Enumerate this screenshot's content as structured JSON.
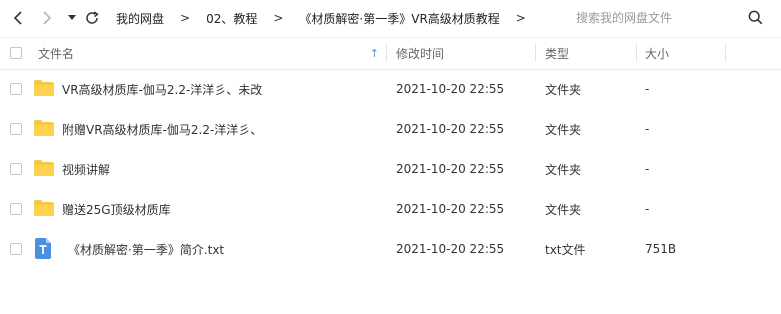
{
  "toolbar": {
    "back_icon": "chevron-left-icon",
    "forward_icon": "chevron-right-icon",
    "history_icon": "caret-down-icon",
    "refresh_icon": "refresh-icon",
    "breadcrumb": [
      {
        "label": "我的网盘"
      },
      {
        "label": "02、教程"
      },
      {
        "label": "《材质解密·第一季》VR高级材质教程"
      }
    ],
    "breadcrumb_separator": ">",
    "search_placeholder": "搜索我的网盘文件"
  },
  "columns": {
    "name": "文件名",
    "modified": "修改时间",
    "type": "类型",
    "size": "大小",
    "sort_indicator": "↑"
  },
  "files": [
    {
      "name": "VR高级材质库-伽马2.2-洋洋彡、未改",
      "modified": "2021-10-20 22:55",
      "type": "文件夹",
      "size": "-",
      "icon": "folder"
    },
    {
      "name": "附赠VR高级材质库-伽马2.2-洋洋彡、",
      "modified": "2021-10-20 22:55",
      "type": "文件夹",
      "size": "-",
      "icon": "folder"
    },
    {
      "name": "视频讲解",
      "modified": "2021-10-20 22:55",
      "type": "文件夹",
      "size": "-",
      "icon": "folder"
    },
    {
      "name": "赠送25G顶级材质库",
      "modified": "2021-10-20 22:55",
      "type": "文件夹",
      "size": "-",
      "icon": "folder"
    },
    {
      "name": "《材质解密·第一季》简介.txt",
      "modified": "2021-10-20 22:55",
      "type": "txt文件",
      "size": "751B",
      "icon": "text-file"
    }
  ],
  "colors": {
    "folder": "#f5c842",
    "text_file": "#4a90e2",
    "sort_indicator": "#4a90e2"
  }
}
